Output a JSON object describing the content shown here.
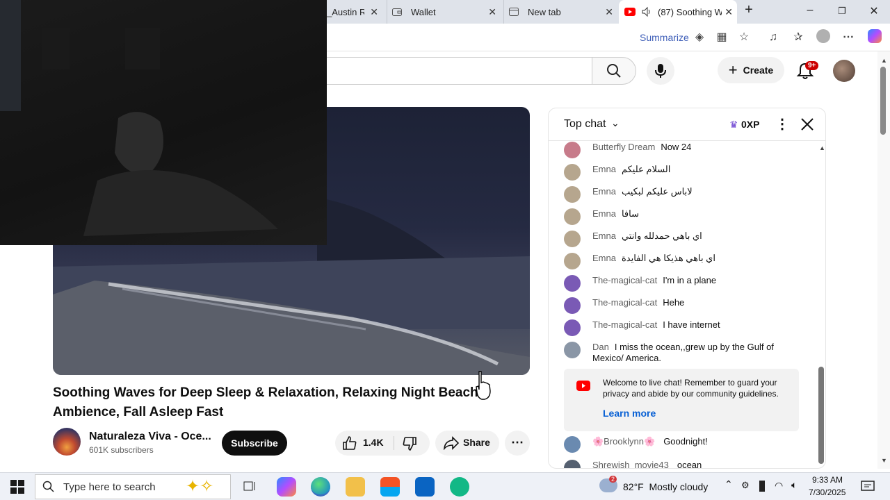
{
  "browser": {
    "tabs": [
      {
        "label": "_Austin Re",
        "active": false
      },
      {
        "label": "Wallet",
        "active": false
      },
      {
        "label": "New tab",
        "active": false
      },
      {
        "label": "(87) Soothing W",
        "active": true
      }
    ],
    "summarize_label": "Summarize"
  },
  "youtube": {
    "create_label": "Create",
    "notification_count": "9+"
  },
  "video": {
    "title": "Soothing Waves for Deep Sleep & Relaxation, Relaxing Night Beach Ambience, Fall Asleep Fast",
    "channel_name": "Naturaleza Viva - Oce...",
    "subscribers": "601K subscribers",
    "subscribe_label": "Subscribe",
    "likes": "1.4K",
    "share_label": "Share"
  },
  "chat": {
    "header_label": "Top chat",
    "xp_label": "0XP",
    "messages": [
      {
        "author": "Butterfly Dream",
        "text": "Now 24",
        "avatar_color": "#c77b8a"
      },
      {
        "author": "Emna",
        "text": "السلام عليكم",
        "avatar_color": "#b6a68e"
      },
      {
        "author": "Emna",
        "text": "لاباس عليكم لبكيب",
        "avatar_color": "#b6a68e"
      },
      {
        "author": "Emna",
        "text": "سافا",
        "avatar_color": "#b6a68e"
      },
      {
        "author": "Emna",
        "text": "اي باهي حمدلله وانتي",
        "avatar_color": "#b6a68e"
      },
      {
        "author": "Emna",
        "text": "اي باهي هذيكا هي الفايدة",
        "avatar_color": "#b6a68e"
      },
      {
        "author": "The-magical-cat",
        "text": "I'm in a plane",
        "avatar_color": "#7a5ab5"
      },
      {
        "author": "The-magical-cat",
        "text": "Hehe",
        "avatar_color": "#7a5ab5"
      },
      {
        "author": "The-magical-cat",
        "text": "I have internet",
        "avatar_color": "#7a5ab5"
      },
      {
        "author": "Dan",
        "text": "I miss the ocean,,grew up by the Gulf of Mexico/ America.",
        "avatar_color": "#8a96a6"
      }
    ],
    "welcome_text": "Welcome to live chat! Remember to guard your privacy and abide by our community guidelines.",
    "learn_more": "Learn more",
    "after_messages": [
      {
        "author": "🌸Brooklynn🌸",
        "text": "Goodnight!",
        "avatar_color": "#6a8ab0"
      },
      {
        "author": "Shrewish_movie43",
        "text": "ocean",
        "avatar_color": "#556070"
      }
    ]
  },
  "taskbar": {
    "search_placeholder": "Type here to search",
    "weather": "82°F  Mostly cloudy",
    "weather_badge": "2",
    "time": "9:33 AM",
    "date": "7/30/2025"
  }
}
